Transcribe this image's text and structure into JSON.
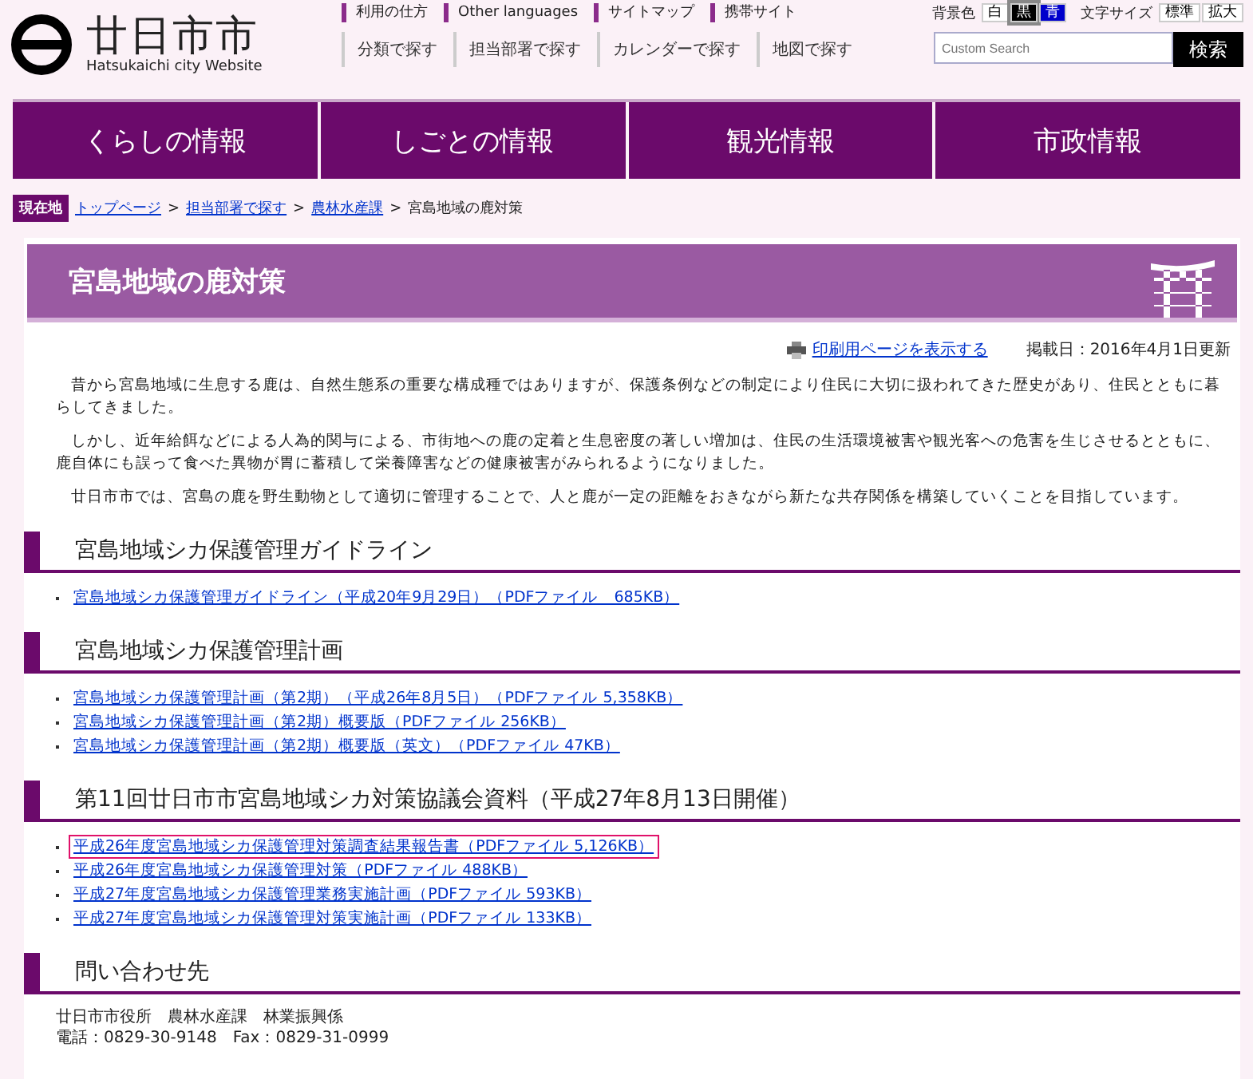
{
  "header": {
    "logo_title": "廿日市市",
    "logo_subtitle": "Hatsukaichi city Website",
    "top_links": [
      "利用の仕方",
      "Other languages",
      "サイトマップ",
      "携帯サイト"
    ],
    "background_label": "背景色",
    "background_options": [
      {
        "label": "白",
        "selected": false,
        "color": "#ffffff"
      },
      {
        "label": "黒",
        "selected": true,
        "color": "#000000"
      },
      {
        "label": "青",
        "selected": false,
        "color": "#0000cc"
      }
    ],
    "text_size_label": "文字サイズ",
    "text_size_options": [
      "標準",
      "拡大"
    ],
    "search_links": [
      "分類で探す",
      "担当部署で探す",
      "カレンダーで探す",
      "地図で探す"
    ],
    "search": {
      "placeholder": "Custom Search",
      "button": "検索"
    }
  },
  "nav": [
    {
      "label": "くらしの情報"
    },
    {
      "label": "しごとの情報"
    },
    {
      "label": "観光情報"
    },
    {
      "label": "市政情報"
    }
  ],
  "breadcrumb": {
    "label": "現在地",
    "links": [
      "トップページ",
      "担当部署で探す",
      "農林水産課"
    ],
    "separator": ">",
    "current": "宮島地域の鹿対策"
  },
  "page": {
    "title": "宮島地域の鹿対策",
    "print_link": "印刷用ページを表示する",
    "posted": "掲載日：2016年4月1日更新",
    "paragraphs": [
      "昔から宮島地域に生息する鹿は、自然生態系の重要な構成種ではありますが、保護条例などの制定により住民に大切に扱われてきた歴史があり、住民とともに暮らしてきました。",
      "しかし、近年給餌などによる人為的関与による、市街地への鹿の定着と生息密度の著しい増加は、住民の生活環境被害や観光客への危害を生じさせるとともに、鹿自体にも誤って食べた異物が胃に蓄積して栄養障害などの健康被害がみられるようになりました。",
      "廿日市市では、宮島の鹿を野生動物として適切に管理することで、人と鹿が一定の距離をおきながら新たな共存関係を構築していくことを目指しています。"
    ],
    "sections": [
      {
        "heading": "宮島地域シカ保護管理ガイドライン",
        "links": [
          {
            "text": "宮島地域シカ保護管理ガイドライン（平成20年9月29日）（PDFファイル　685KB）",
            "highlighted": false
          }
        ]
      },
      {
        "heading": "宮島地域シカ保護管理計画",
        "links": [
          {
            "text": "宮島地域シカ保護管理計画（第2期）（平成26年8月5日）（PDFファイル 5,358KB）",
            "highlighted": false
          },
          {
            "text": "宮島地域シカ保護管理計画（第2期）概要版（PDFファイル 256KB）",
            "highlighted": false
          },
          {
            "text": "宮島地域シカ保護管理計画（第2期）概要版（英文）（PDFファイル 47KB）",
            "highlighted": false
          }
        ]
      },
      {
        "heading": "第11回廿日市市宮島地域シカ対策協議会資料（平成27年8月13日開催）",
        "links": [
          {
            "text": "平成26年度宮島地域シカ保護管理対策調査結果報告書（PDFファイル 5,126KB）",
            "highlighted": true
          },
          {
            "text": "平成26年度宮島地域シカ保護管理対策（PDFファイル 488KB）",
            "highlighted": false
          },
          {
            "text": "平成27年度宮島地域シカ保護管理業務実施計画（PDFファイル 593KB）",
            "highlighted": false
          },
          {
            "text": "平成27年度宮島地域シカ保護管理対策実施計画（PDFファイル 133KB）",
            "highlighted": false
          }
        ]
      },
      {
        "heading": "問い合わせ先",
        "lines": [
          "廿日市市役所　農林水産課　林業振興係",
          "電話：0829-30-9148　Fax：0829-31-0999"
        ]
      }
    ]
  }
}
